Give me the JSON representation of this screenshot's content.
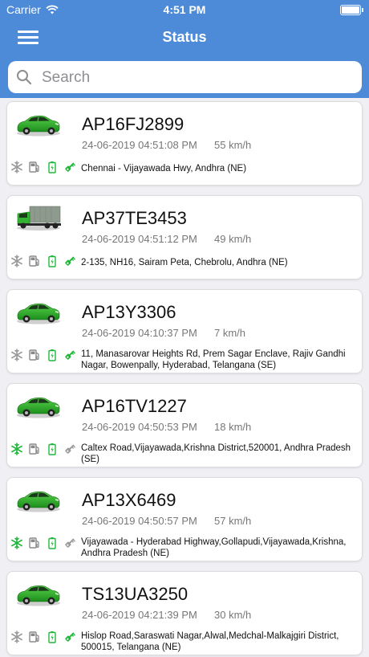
{
  "status_bar": {
    "carrier": "Carrier",
    "time": "4:51 PM"
  },
  "header": {
    "title": "Status"
  },
  "search": {
    "placeholder": "Search"
  },
  "colors": {
    "header": "#4d8bd9",
    "active_green": "#1fb83a",
    "inactive_grey": "#a8a8a8"
  },
  "vehicles": [
    {
      "plate": "AP16FJ2899",
      "datetime": "24-06-2019 04:51:08 PM",
      "speed": "55 km/h",
      "address": "Chennai - Vijayawada Hwy, Andhra (NE)",
      "type": "car-icon",
      "ac": "ac-off-icon",
      "ignition": "ignition-on-icon"
    },
    {
      "plate": "AP37TE3453",
      "datetime": "24-06-2019 04:51:12 PM",
      "speed": "49 km/h",
      "address": "2-135, NH16, Sairam Peta, Chebrolu, Andhra (NE)",
      "type": "truck-icon",
      "ac": "ac-off-icon",
      "ignition": "ignition-on-icon"
    },
    {
      "plate": "AP13Y3306",
      "datetime": "24-06-2019 04:10:37 PM",
      "speed": "7 km/h",
      "address": "11, Manasarovar Heights Rd, Prem Sagar Enclave, Rajiv Gandhi Nagar, Bowenpally, Hyderabad, Telangana (SE)",
      "type": "car-icon",
      "ac": "ac-off-icon",
      "ignition": "ignition-on-icon"
    },
    {
      "plate": "AP16TV1227",
      "datetime": "24-06-2019 04:50:53 PM",
      "speed": "18 km/h",
      "address": "Caltex Road,Vijayawada,Krishna District,520001, Andhra Pradesh (SE)",
      "type": "car-icon",
      "ac": "ac-on-icon",
      "ignition": "ignition-off-icon"
    },
    {
      "plate": "AP13X6469",
      "datetime": "24-06-2019 04:50:57 PM",
      "speed": "57 km/h",
      "address": "Vijayawada - Hyderabad Highway,Gollapudi,Vijayawada,Krishna, Andhra Pradesh (NE)",
      "type": "car-icon",
      "ac": "ac-on-icon",
      "ignition": "ignition-off-icon"
    },
    {
      "plate": "TS13UA3250",
      "datetime": "24-06-2019 04:21:39 PM",
      "speed": "30 km/h",
      "address": "Hislop Road,Saraswati Nagar,Alwal,Medchal-Malkajgiri District, 500015, Telangana (NE)",
      "type": "car-icon",
      "ac": "ac-off-icon",
      "ignition": "ignition-on-icon"
    }
  ]
}
